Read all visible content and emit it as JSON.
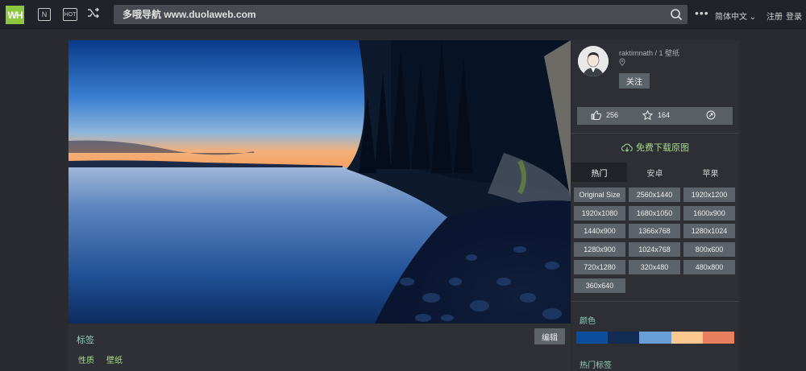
{
  "header": {
    "logo": "WH",
    "nav_n": "N",
    "nav_hot": "HOT",
    "search_placeholder": "多哦导航 www.duolaweb.com",
    "more": "•••",
    "language": "简体中文 ⌄",
    "register": "注册",
    "login": "登录"
  },
  "tags_section": {
    "title": "标签",
    "edit": "编辑",
    "tags": [
      "性质",
      "壁纸"
    ]
  },
  "sidebar": {
    "author": "raktimnath / 1 壁纸",
    "follow": "关注",
    "likes": "256",
    "favorites": "164",
    "download": "免费下载原图",
    "tabs": [
      "热门",
      "安卓",
      "苹果"
    ],
    "resolutions": [
      "Original Size",
      "2560x1440",
      "1920x1200",
      "1920x1080",
      "1680x1050",
      "1600x900",
      "1440x900",
      "1366x768",
      "1280x1024",
      "1280x900",
      "1024x768",
      "800x600",
      "720x1280",
      "320x480",
      "480x800",
      "360x640"
    ],
    "colors_title": "颜色",
    "colors": [
      "#0b4e9e",
      "#112b55",
      "#6a9ed8",
      "#fbc98f",
      "#e88060"
    ],
    "hot_tags_title": "热门标签"
  },
  "icons": {
    "like": "thumbs-up-icon",
    "favorite": "star-icon",
    "share": "share-icon",
    "download": "cloud-download-icon",
    "search": "search-icon",
    "shuffle": "shuffle-icon",
    "location": "location-pin-icon"
  }
}
